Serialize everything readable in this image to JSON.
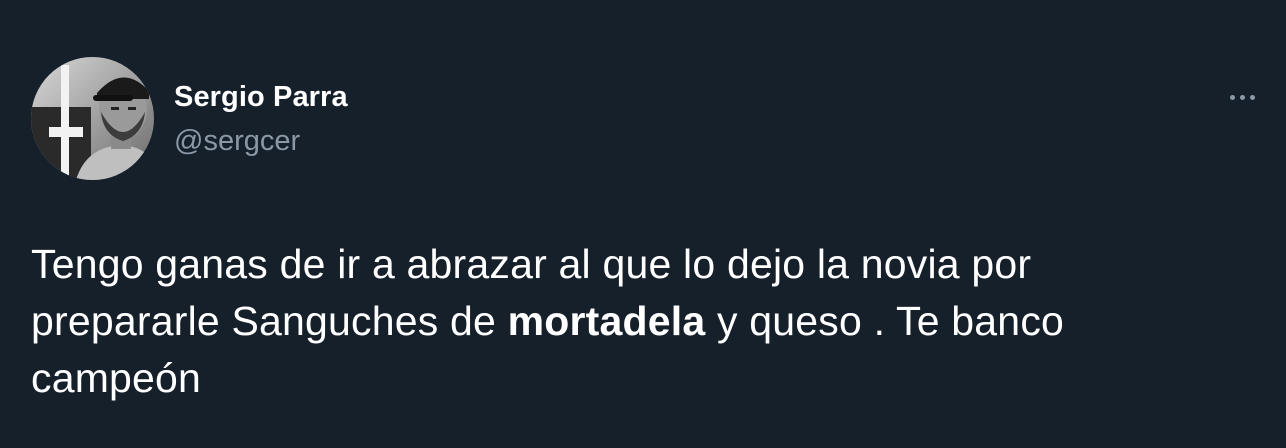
{
  "author": {
    "display_name": "Sergio Parra",
    "handle": "@sergcer",
    "avatar_icon": "profile-photo"
  },
  "more_options_icon": "more-options-icon",
  "tweet": {
    "text_part1": "Tengo ganas de ir a abrazar al que lo dejo la novia por prepararle Sanguches de ",
    "text_bold": "mortadela",
    "text_part2": " y queso . Te banco campeón"
  },
  "colors": {
    "background": "#15202b",
    "primary_text": "#ffffff",
    "secondary_text": "#8b98a5"
  }
}
